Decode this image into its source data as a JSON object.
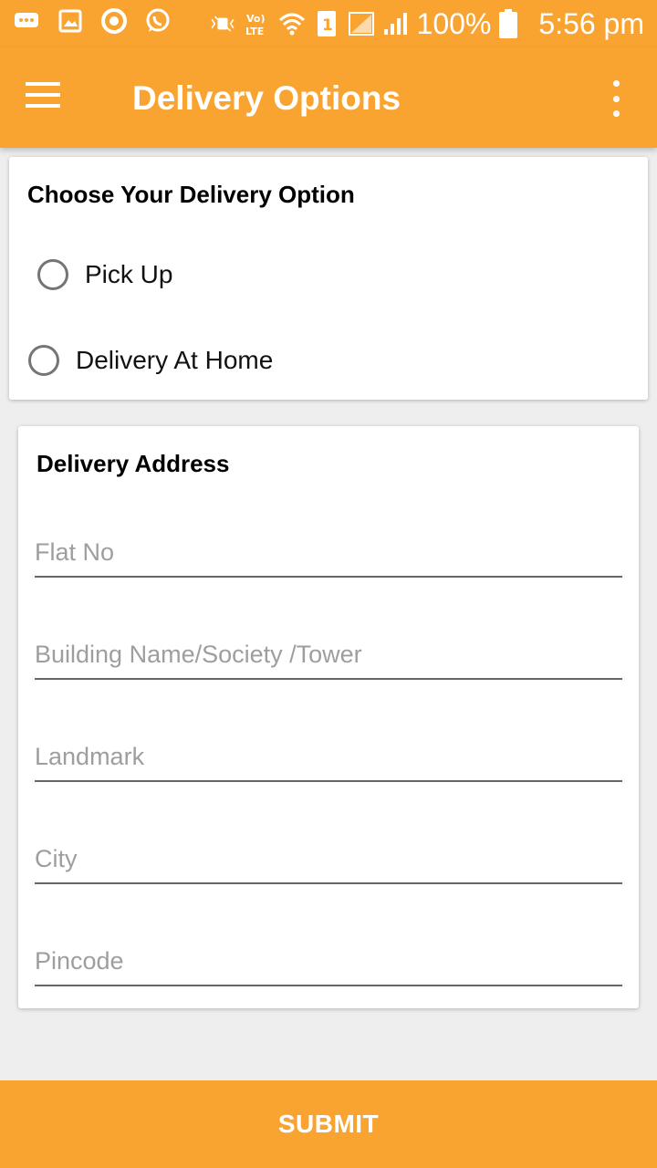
{
  "status_bar": {
    "battery_percent": "100%",
    "time": "5:56 pm",
    "sim_slot": "1",
    "network_label": "Vo) LTE",
    "left_icons": [
      "message-icon",
      "image-icon",
      "sync-icon",
      "whatsapp-icon"
    ],
    "right_icons": [
      "mute-icon",
      "volte-icon",
      "wifi-icon",
      "sim-icon",
      "signal-empty-icon",
      "signal-icon",
      "battery-icon"
    ]
  },
  "app_bar": {
    "title": "Delivery Options",
    "left_icon": "hamburger-menu-icon",
    "right_icon": "overflow-menu-icon"
  },
  "delivery_option": {
    "title": "Choose Your Delivery Option",
    "options": [
      {
        "label": "Pick Up",
        "selected": false
      },
      {
        "label": "Delivery At Home",
        "selected": false
      }
    ]
  },
  "delivery_address": {
    "title": "Delivery Address",
    "fields": [
      {
        "placeholder": "Flat No",
        "value": ""
      },
      {
        "placeholder": "Building Name/Society /Tower",
        "value": ""
      },
      {
        "placeholder": "Landmark",
        "value": ""
      },
      {
        "placeholder": "City",
        "value": ""
      },
      {
        "placeholder": "Pincode",
        "value": ""
      }
    ]
  },
  "submit": {
    "label": "SUBMIT"
  },
  "colors": {
    "accent": "#f9a431",
    "background": "#eeeeee",
    "card": "#ffffff",
    "radio_border": "#757575",
    "placeholder": "#9e9e9e"
  }
}
